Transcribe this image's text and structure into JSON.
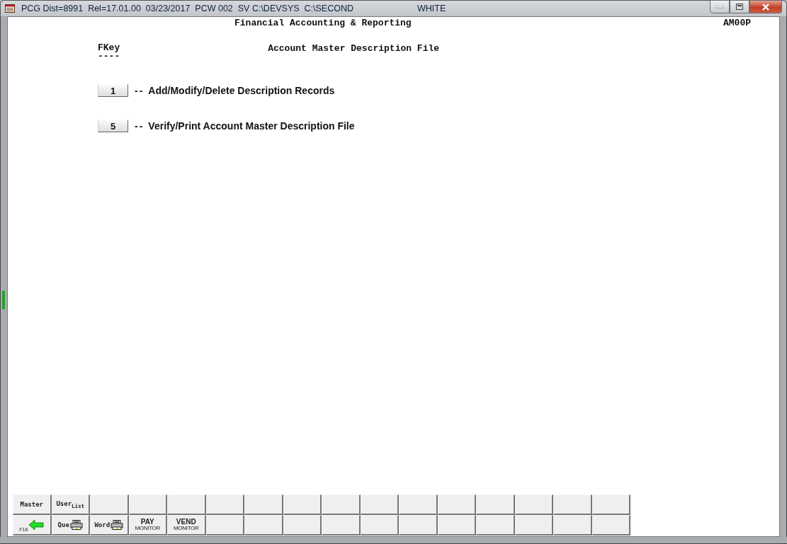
{
  "window": {
    "title": "PCG Dist=8991  Rel=17.01.00  03/23/2017  PCW 002  SV C:\\DEVSYS  C:\\SECOND",
    "user": "WHITE"
  },
  "header": {
    "title": "Financial Accounting & Reporting",
    "program_id": "AM00P"
  },
  "menu": {
    "fkey_heading": "FKey",
    "fkey_rule": "----",
    "title": "Account Master Description File",
    "options": [
      {
        "key": "1",
        "separator": "--",
        "description": "Add/Modify/Delete Description Records"
      },
      {
        "key": "5",
        "separator": "--",
        "description": "Verify/Print Account Master Description File"
      }
    ]
  },
  "toolbar": {
    "rows": [
      [
        {
          "kind": "text",
          "label": "Master"
        },
        {
          "kind": "text",
          "label": "User$_{List}$"
        }
      ],
      [
        {
          "kind": "back",
          "label": "F16"
        },
        {
          "kind": "printer",
          "label": "Que"
        },
        {
          "kind": "printer",
          "label": "Word"
        },
        {
          "kind": "monitor",
          "label": "PAY",
          "sublabel": "MONITOR"
        },
        {
          "kind": "monitor",
          "label": "VEND",
          "sublabel": "MONITOR"
        }
      ]
    ]
  }
}
